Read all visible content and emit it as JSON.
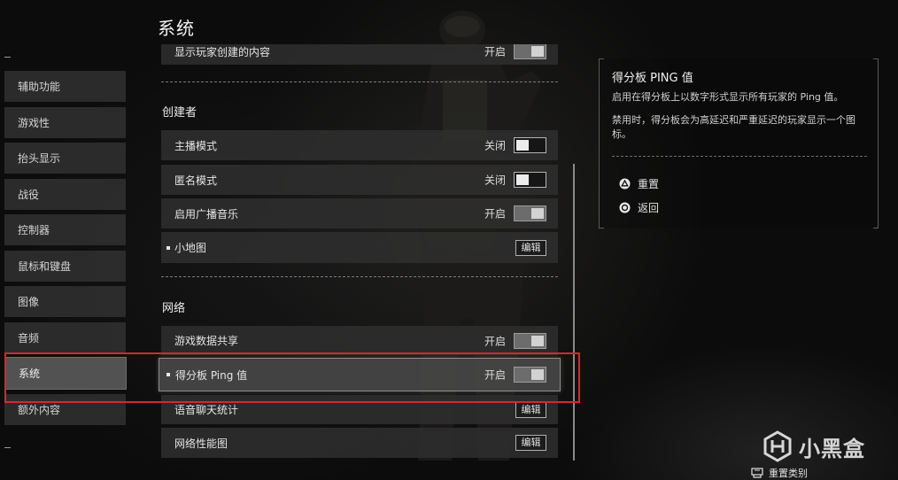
{
  "page": {
    "title": "系统"
  },
  "sidebar": {
    "items": [
      {
        "label": "辅助功能"
      },
      {
        "label": "游戏性"
      },
      {
        "label": "抬头显示"
      },
      {
        "label": "战役"
      },
      {
        "label": "控制器"
      },
      {
        "label": "鼠标和键盘"
      },
      {
        "label": "图像"
      },
      {
        "label": "音频"
      },
      {
        "label": "系统",
        "selected": true
      },
      {
        "label": "额外内容"
      }
    ]
  },
  "settings": {
    "top_row": {
      "label": "显示玩家创建的内容",
      "state": "开启",
      "on": true
    },
    "sections": [
      {
        "title": "创建者",
        "rows": [
          {
            "label": "主播模式",
            "state": "关闭",
            "on": false
          },
          {
            "label": "匿名模式",
            "state": "关闭",
            "on": false
          },
          {
            "label": "启用广播音乐",
            "state": "开启",
            "on": true
          },
          {
            "label": "小地图",
            "bullet": true,
            "button": "编辑"
          }
        ]
      },
      {
        "title": "网络",
        "rows": [
          {
            "label": "游戏数据共享",
            "state": "开启",
            "on": true
          },
          {
            "label": "得分板 Ping 值",
            "bullet": true,
            "state": "开启",
            "on": true,
            "selected": true
          },
          {
            "label": "语音聊天统计",
            "button": "编辑"
          },
          {
            "label": "网络性能图",
            "button": "编辑"
          }
        ]
      }
    ]
  },
  "detail": {
    "title": "得分板 PING 值",
    "description": "启用在得分板上以数字形式显示所有玩家的 Ping 值。",
    "note": "禁用时，得分板会为高延迟和严重延迟的玩家显示一个图标。",
    "actions": [
      {
        "icon": "triangle-button-icon",
        "label": "重置"
      },
      {
        "icon": "circle-button-icon",
        "label": "返回"
      }
    ]
  },
  "footer": {
    "icon": "touchpad-icon",
    "label": "重置类别"
  },
  "watermark": {
    "icon": "xiaoheihe-logo-icon",
    "label": "小黑盒"
  },
  "colors": {
    "annotation": "#d9262c",
    "toggle_on": "#6c6c6c",
    "toggle_knob": "#ececec"
  }
}
